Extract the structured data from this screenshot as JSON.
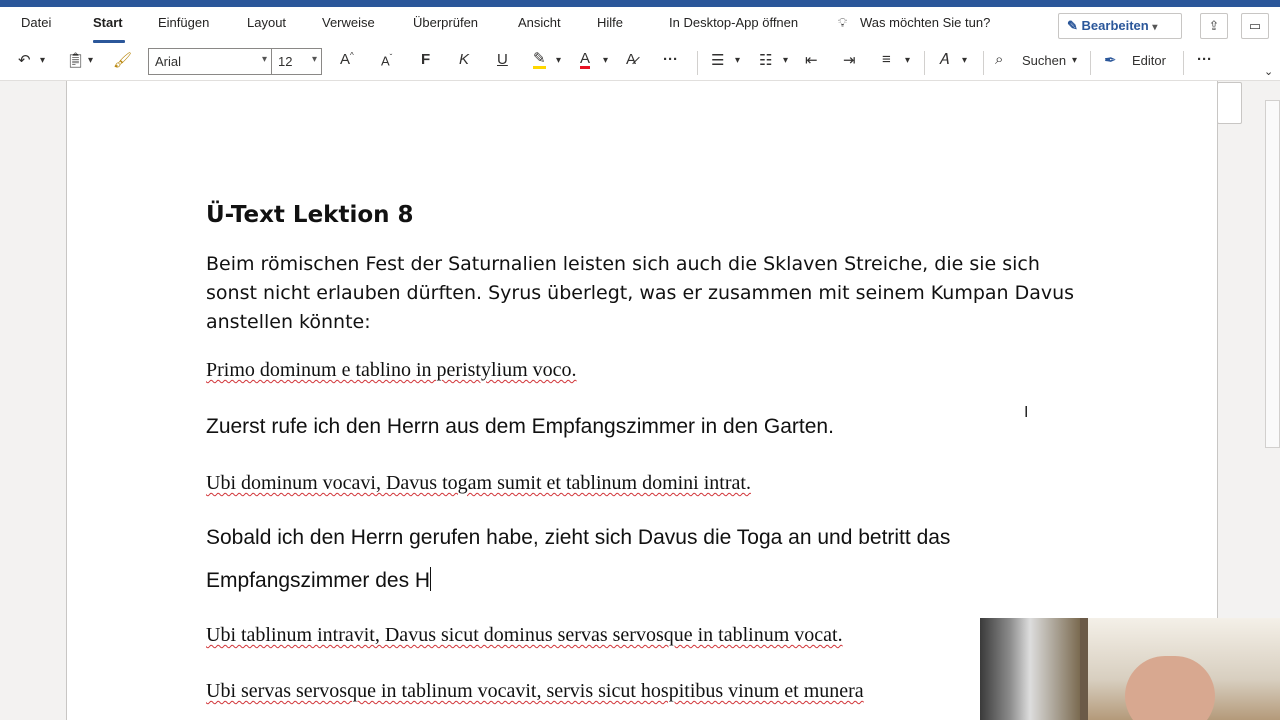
{
  "menu_tabs": [
    "Datei",
    "Start",
    "Einfügen",
    "Layout",
    "Verweise",
    "Überprüfen",
    "Ansicht",
    "Hilfe",
    "In Desktop-App öffnen"
  ],
  "tell_me": "Was möchten Sie tun?",
  "edit_button": "Bearbeiten",
  "toolbar": {
    "font_name": "Arial",
    "font_size": "12",
    "bold": "F",
    "italic": "K",
    "underline": "U",
    "search": "Suchen",
    "editor": "Editor"
  },
  "document": {
    "title": "Ü-Text Lektion 8",
    "intro": "Beim römischen Fest der Saturnalien leisten sich auch die Sklaven Streiche, die sie sich sonst nicht erlauben dürften. Syrus überlegt, was er zusammen mit seinem Kumpan Davus anstellen könnte:",
    "latin_1": "Primo dominum e tablino in peristylium voco.",
    "german_1": "Zuerst rufe ich den Herrn aus dem Empfangszimmer in den Garten.",
    "latin_2": "Ubi dominum vocavi, Davus togam sumit et tablinum domini intrat.",
    "german_2_line1": "Sobald ich den Herrn gerufen habe, zieht sich Davus die Toga an und betritt das",
    "german_2_line2": "Empfangszimmer des H",
    "latin_3": "Ubi tablinum intravit, Davus sicut dominus servas servosque in tablinum vocat.",
    "latin_4": "Ubi servas servosque in tablinum vocavit, servis sicut hospitibus vinum et munera"
  },
  "colors": {
    "accent": "#2b579a",
    "spell_error": "#d13438",
    "highlight": "#ffd700",
    "font_color": "#e81123"
  }
}
